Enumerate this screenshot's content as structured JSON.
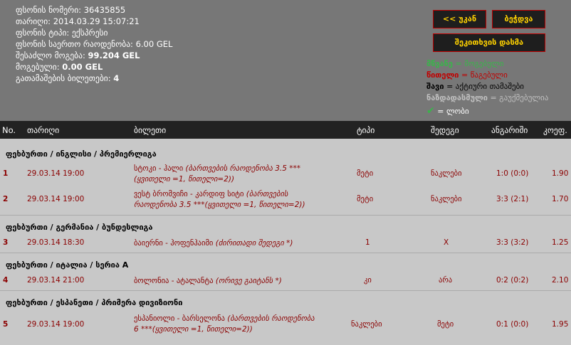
{
  "info": {
    "ticket_number_label": "ფსონის ნომერი:",
    "ticket_number": "36435855",
    "date_label": "თარიღი:",
    "date": "2014.03.29 15:07:21",
    "type_label": "ფსონის ტიპი:",
    "type": "ექსპრესი",
    "total_stake_label": "ფსონის საერთო რაოდენობა:",
    "total_stake": "6.00 GEL",
    "possible_win_label": "შესაძლო მოგება:",
    "possible_win": "99.204 GEL",
    "won_label": "მოგებული:",
    "won": "0.00 GEL",
    "matches_count_label": "გათამაშების ბილეთები:",
    "matches_count": "4"
  },
  "buttons": {
    "back": "<< უკან",
    "print": "ბეჭდვა",
    "place_bet": "შეკითხვის დასმა"
  },
  "legend": {
    "green_key": "მწვანე",
    "green_text": "= მოგებული",
    "red_key": "წითელი",
    "red_text": "= წაგებული",
    "black_key": "შავი",
    "black_text": "= აქტიური თამაშები",
    "gray_key": "ნაზდადასმული",
    "gray_text": "= გაუქმებულია",
    "check_text": "= ლობი",
    "colors": {
      "green": "#39b54a",
      "red": "#c00000",
      "black": "#000000",
      "gray": "#c0c0c0"
    }
  },
  "table": {
    "headers": {
      "no": "No.",
      "date": "თარიღი",
      "event": "ბილეთი",
      "type": "ტიპი",
      "outcome": "შედეგი",
      "score": "ანგარიში",
      "coef": "კოეფ."
    },
    "groups": [
      {
        "title": "ფეხბურთი / ინგლისი / პრემიერლიგა"
      },
      {
        "title": "ფეხბურთი / გერმანია / ბუნდესლიგა"
      },
      {
        "title": "ფეხბურთი / იტალია / სერია A"
      },
      {
        "title": "ფეხბურთი / ესპანეთი / პრიმერა დივიზიონი"
      }
    ],
    "rows": [
      {
        "no": "1",
        "date": "29.03.14 19:00",
        "event": "სტოკი - ჰალი",
        "event_note": "(ბართვების რაოდენობა 3.5 *** (ყვითელი =1, წითელი=2))",
        "type": "მეტი",
        "outcome": "ნაკლები",
        "score": "1:0 (0:0)",
        "coef": "1.90"
      },
      {
        "no": "2",
        "date": "29.03.14 19:00",
        "event": "ვესტ ბრომვიჩი - კარდიფ სიტი",
        "event_note": "(ბართვების რაოდენობა 3.5 ***(ყვითელი =1, წითელი=2))",
        "type": "მეტი",
        "outcome": "ნაკლები",
        "score": "3:3 (2:1)",
        "coef": "1.70"
      },
      {
        "no": "3",
        "date": "29.03.14 18:30",
        "event": "ბაიერნი - ჰოფენჰაიმი",
        "event_note": "(ძირითადი შედეგი *)",
        "type": "1",
        "outcome": "X",
        "score": "3:3 (3:2)",
        "coef": "1.25"
      },
      {
        "no": "4",
        "date": "29.03.14 21:00",
        "event": "ბოლონია - ატალანტა",
        "event_note": "(ორივე გაიტანს *)",
        "type": "კი",
        "outcome": "არა",
        "score": "0:2 (0:2)",
        "coef": "2.10"
      },
      {
        "no": "5",
        "date": "29.03.14 19:00",
        "event": "ესპანიოლი - ბარსელონა",
        "event_note": "(ბართვების რაოდენობა 6 ***(ყვითელი =1, წითელი=2))",
        "type": "ნაკლები",
        "outcome": "მეტი",
        "score": "0:1 (0:0)",
        "coef": "1.95"
      }
    ]
  }
}
